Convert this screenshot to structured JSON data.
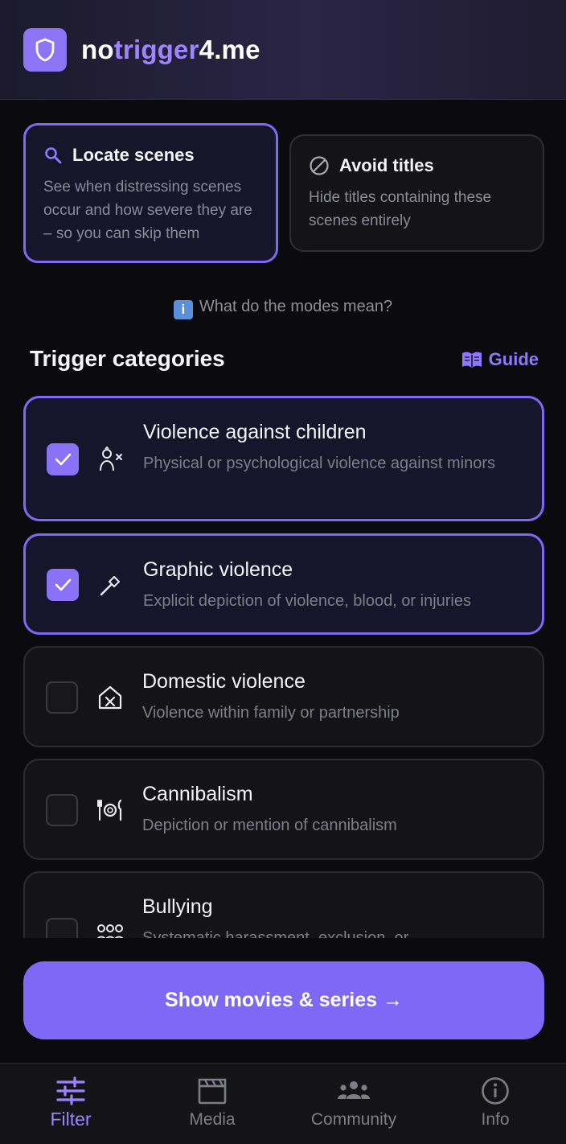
{
  "header": {
    "brand_a": "no",
    "brand_b": "trigger",
    "brand_c": "4.me"
  },
  "modes": [
    {
      "title": "Locate scenes",
      "desc": "See when distressing scenes occur and how severe they are – so you can skip them",
      "icon": "search-icon",
      "active": true
    },
    {
      "title": "Avoid titles",
      "desc": "Hide titles containing these scenes entirely",
      "icon": "block-icon",
      "active": false
    }
  ],
  "modes_help": {
    "icon": "info-icon",
    "text": "What do the modes mean?"
  },
  "section": {
    "title": "Trigger categories",
    "guide_label": "Guide"
  },
  "categories": [
    {
      "title": "Violence against children",
      "desc": "Physical or psychological violence against minors",
      "checked": true,
      "icon": "child-icon"
    },
    {
      "title": "Graphic violence",
      "desc": "Explicit depiction of violence, blood, or injuries",
      "checked": true,
      "icon": "knife-icon"
    },
    {
      "title": "Domestic violence",
      "desc": "Violence within family or partnership",
      "checked": false,
      "icon": "house-x-icon"
    },
    {
      "title": "Cannibalism",
      "desc": "Depiction or mention of cannibalism",
      "checked": false,
      "icon": "plate-icon"
    },
    {
      "title": "Bullying",
      "desc": "Systematic harassment, exclusion, or",
      "checked": false,
      "icon": "group-icon"
    }
  ],
  "cta": {
    "label": "Show movies & series →"
  },
  "nav": [
    {
      "label": "Filter",
      "icon": "sliders-icon",
      "active": true
    },
    {
      "label": "Media",
      "icon": "clapperboard-icon",
      "active": false
    },
    {
      "label": "Community",
      "icon": "people-icon",
      "active": false
    },
    {
      "label": "Info",
      "icon": "info-circle-icon",
      "active": false
    }
  ],
  "colors": {
    "accent": "#7f68f2",
    "background": "#0b0b0f",
    "card": "#141418"
  }
}
